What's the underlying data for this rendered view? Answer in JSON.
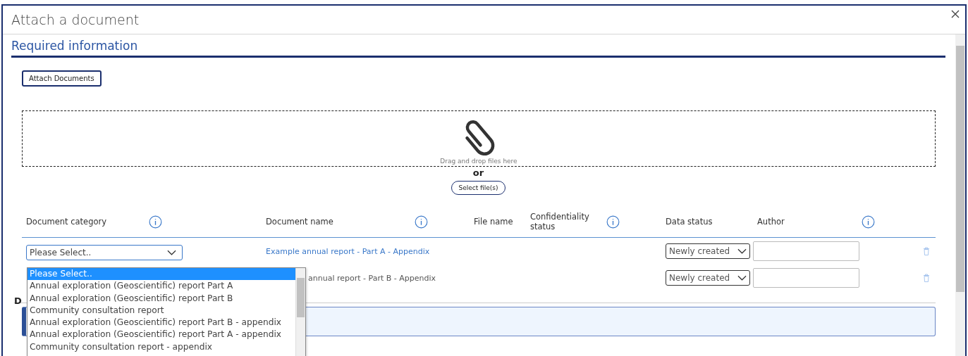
{
  "window": {
    "title": "Attach a document"
  },
  "section": {
    "title": "Required information"
  },
  "attach_button": "Attach Documents",
  "dropzone": {
    "hint": "Drag and drop files here",
    "or": "or",
    "select_button": "Select file(s)"
  },
  "table": {
    "columns": [
      {
        "label": "Document category",
        "info": true
      },
      {
        "label": "Document name",
        "info": true
      },
      {
        "label": "File name",
        "info": false
      },
      {
        "label": "Confidentiality status",
        "info": true
      },
      {
        "label": "Data status",
        "info": false
      },
      {
        "label": "Author",
        "info": true
      }
    ],
    "rows": [
      {
        "category": "Please Select..",
        "document_name": "Example annual report - Part A - Appendix",
        "name_covered": false,
        "data_status": "Newly created",
        "author": ""
      },
      {
        "category": "",
        "document_name": "annual report - Part B - Appendix",
        "name_covered": true,
        "data_status": "Newly created",
        "author": ""
      }
    ]
  },
  "category_list": {
    "options": [
      {
        "label": "Please Select..",
        "selected": true
      },
      {
        "label": "Annual exploration (Geoscientific) report Part A",
        "selected": false
      },
      {
        "label": "Annual exploration (Geoscientific) report Part B",
        "selected": false
      },
      {
        "label": "Community consultation report",
        "selected": false
      },
      {
        "label": "Annual exploration (Geoscientific) report Part B - appendix",
        "selected": false
      },
      {
        "label": "Annual exploration (Geoscientific) report Part A - appendix",
        "selected": false
      },
      {
        "label": "Community consultation report - appendix",
        "selected": false
      }
    ]
  },
  "next_section": {
    "title": "D"
  }
}
